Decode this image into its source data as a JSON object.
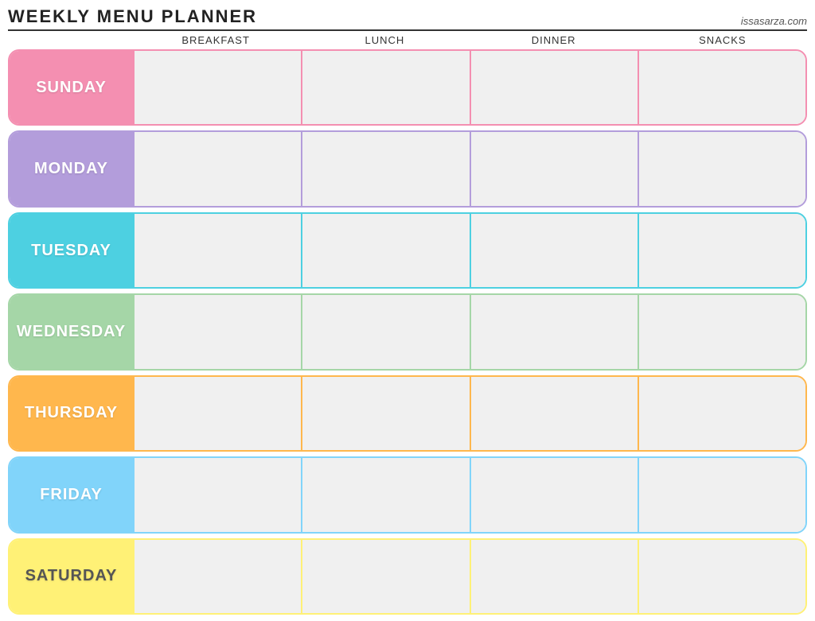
{
  "header": {
    "title": "Weekly Menu Planner",
    "siteUrl": "issasarza.com"
  },
  "columns": {
    "spacer": "",
    "breakfast": "Breakfast",
    "lunch": "Lunch",
    "dinner": "Dinner",
    "snacks": "Snacks"
  },
  "days": [
    {
      "id": "sunday",
      "label": "Sunday",
      "colorClass": "row-sunday",
      "color": "#f48fb1"
    },
    {
      "id": "monday",
      "label": "Monday",
      "colorClass": "row-monday",
      "color": "#b39ddb"
    },
    {
      "id": "tuesday",
      "label": "Tuesday",
      "colorClass": "row-tuesday",
      "color": "#4dd0e1"
    },
    {
      "id": "wednesday",
      "label": "Wednesday",
      "colorClass": "row-wednesday",
      "color": "#a5d6a7"
    },
    {
      "id": "thursday",
      "label": "Thursday",
      "colorClass": "row-thursday",
      "color": "#ffb74d"
    },
    {
      "id": "friday",
      "label": "Friday",
      "colorClass": "row-friday",
      "color": "#81d4fa"
    },
    {
      "id": "saturday",
      "label": "Saturday",
      "colorClass": "row-saturday",
      "color": "#fff176"
    }
  ]
}
